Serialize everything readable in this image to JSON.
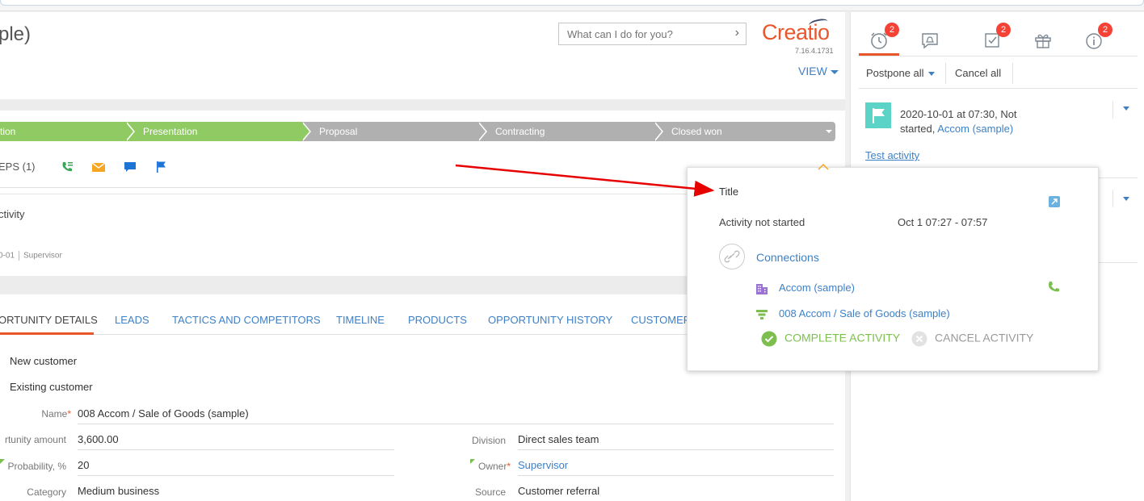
{
  "page": {
    "title": "ple)"
  },
  "header": {
    "search_placeholder": "What can I do for you?",
    "logo_text": "Creatio",
    "version": "7.16.4.1731",
    "view_label": "VIEW"
  },
  "stages": {
    "items": [
      "tion",
      "Presentation",
      "Proposal",
      "Contracting",
      "Closed won"
    ],
    "active_color": "#8fcb62",
    "inactive_color": "#b0b0b0"
  },
  "next_steps": {
    "label": "EPS (1)"
  },
  "activity_card": {
    "title": "ctivity",
    "date": "0-01",
    "owner": "Supervisor"
  },
  "tabs": [
    "ORTUNITY DETAILS",
    "LEADS",
    "TACTICS AND COMPETITORS",
    "TIMELINE",
    "PRODUCTS",
    "OPPORTUNITY HISTORY",
    "CUSTOMER"
  ],
  "details": {
    "option_new": "New customer",
    "option_existing": "Existing customer",
    "name_label": "Name",
    "name_value": "008 Accom / Sale of Goods (sample)",
    "amount_label": "rtunity amount",
    "amount_value": "3,600.00",
    "probability_label": "Probability, %",
    "probability_value": "20",
    "category_label": "Category",
    "category_value": "Medium business",
    "division_label": "Division",
    "division_value": "Direct sales team",
    "owner_label": "Owner",
    "owner_value": "Supervisor",
    "source_label": "Source",
    "source_value": "Customer referral",
    "required_mark": "*"
  },
  "right_panel": {
    "badges": [
      "2",
      "2",
      "2"
    ],
    "postpone_label": "Postpone all",
    "cancel_label": "Cancel all",
    "reminder_text": "2020-10-01 at 07:30,  Not started,",
    "reminder_link": "Accom (sample)",
    "activity_link": "Test activity"
  },
  "popup": {
    "title": "Title",
    "status": "Activity not started",
    "time": "Oct 1 07:27 - 07:57",
    "connections_label": "Connections",
    "account_link": "Accom (sample)",
    "opportunity_link": "008 Accom / Sale of Goods (sample)",
    "complete_label": "COMPLETE ACTIVITY",
    "cancel_label": "CANCEL ACTIVITY"
  },
  "colors": {
    "accent": "#e9562c",
    "link": "#3e80c6",
    "green": "#7cbf4f",
    "annotation_arrow": "#e60000"
  }
}
